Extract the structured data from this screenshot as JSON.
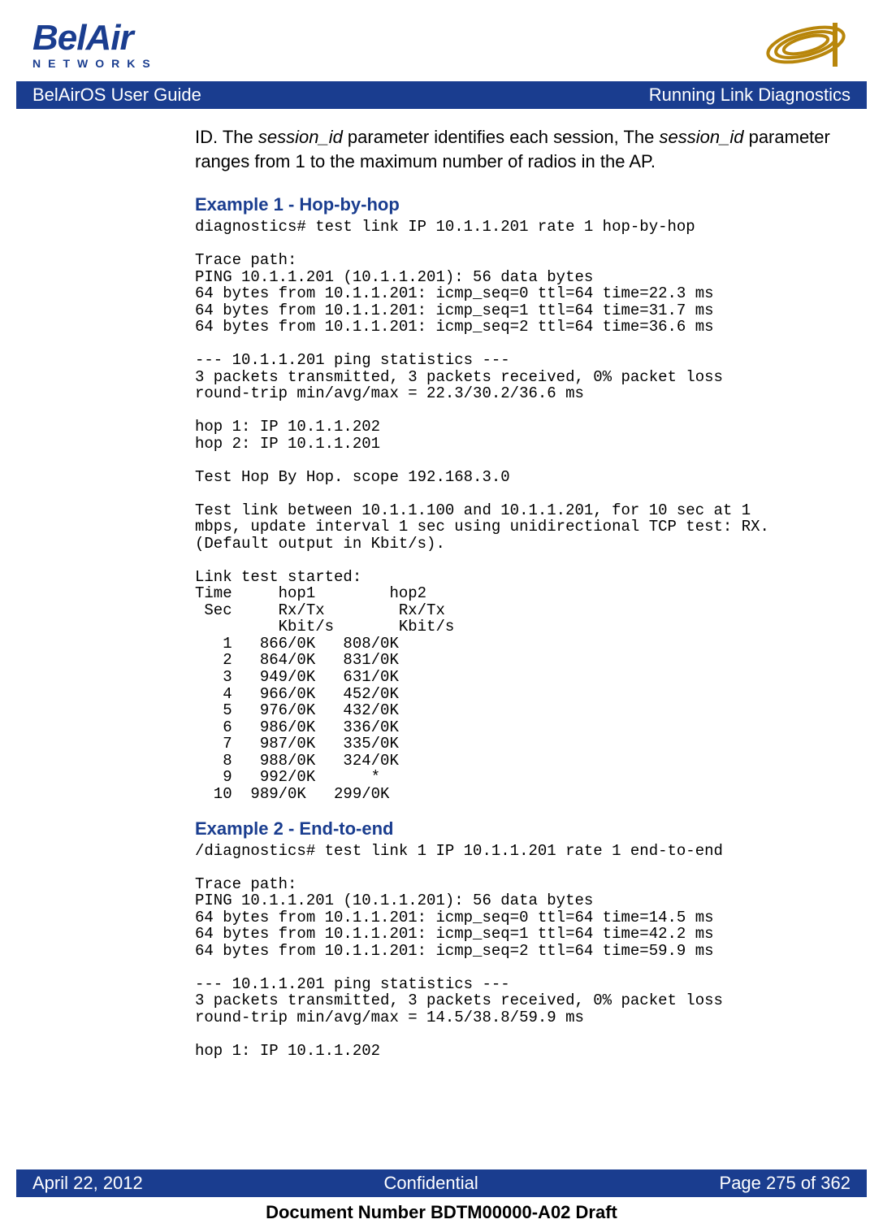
{
  "header": {
    "logo_main": "BelAir",
    "logo_sub": "NETWORKS"
  },
  "title_bar": {
    "left": "BelAirOS User Guide",
    "right": "Running Link Diagnostics"
  },
  "body": {
    "para_prefix": "ID. The ",
    "para_em1": "session_id",
    "para_mid": " parameter identifies each session, The ",
    "para_em2": "session_id",
    "para_suffix": " parameter ranges from 1 to the maximum number of radios in the AP."
  },
  "example1": {
    "heading": "Example 1 - Hop-by-hop",
    "code": "diagnostics# test link IP 10.1.1.201 rate 1 hop-by-hop\n\nTrace path:\nPING 10.1.1.201 (10.1.1.201): 56 data bytes\n64 bytes from 10.1.1.201: icmp_seq=0 ttl=64 time=22.3 ms\n64 bytes from 10.1.1.201: icmp_seq=1 ttl=64 time=31.7 ms\n64 bytes from 10.1.1.201: icmp_seq=2 ttl=64 time=36.6 ms\n\n--- 10.1.1.201 ping statistics ---\n3 packets transmitted, 3 packets received, 0% packet loss\nround-trip min/avg/max = 22.3/30.2/36.6 ms\n\nhop 1: IP 10.1.1.202\nhop 2: IP 10.1.1.201\n\nTest Hop By Hop. scope 192.168.3.0\n\nTest link between 10.1.1.100 and 10.1.1.201, for 10 sec at 1\nmbps, update interval 1 sec using unidirectional TCP test: RX.\n(Default output in Kbit/s).\n\nLink test started:\nTime     hop1        hop2\n Sec     Rx/Tx        Rx/Tx\n         Kbit/s       Kbit/s\n   1   866/0K   808/0K\n   2   864/0K   831/0K\n   3   949/0K   631/0K\n   4   966/0K   452/0K\n   5   976/0K   432/0K\n   6   986/0K   336/0K\n   7   987/0K   335/0K\n   8   988/0K   324/0K\n   9   992/0K      *\n  10  989/0K   299/0K"
  },
  "example2": {
    "heading": "Example 2 - End-to-end",
    "code": "/diagnostics# test link 1 IP 10.1.1.201 rate 1 end-to-end\n\nTrace path:\nPING 10.1.1.201 (10.1.1.201): 56 data bytes\n64 bytes from 10.1.1.201: icmp_seq=0 ttl=64 time=14.5 ms\n64 bytes from 10.1.1.201: icmp_seq=1 ttl=64 time=42.2 ms\n64 bytes from 10.1.1.201: icmp_seq=2 ttl=64 time=59.9 ms\n\n--- 10.1.1.201 ping statistics ---\n3 packets transmitted, 3 packets received, 0% packet loss\nround-trip min/avg/max = 14.5/38.8/59.9 ms\n\nhop 1: IP 10.1.1.202"
  },
  "footer": {
    "left": "April 22, 2012",
    "center": "Confidential",
    "right": "Page 275 of 362",
    "docnum": "Document Number BDTM00000-A02 Draft"
  }
}
